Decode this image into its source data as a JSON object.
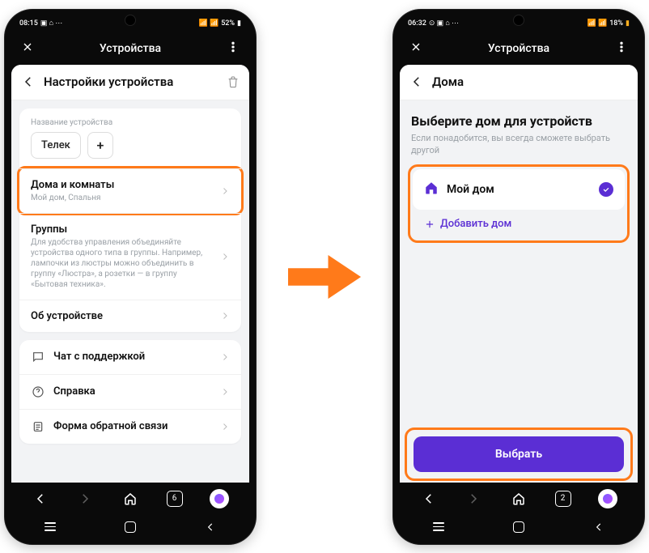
{
  "phone1": {
    "status": {
      "time": "08:15",
      "battery": "52%"
    },
    "topbar": {
      "title": "Устройства"
    },
    "subheader": {
      "title": "Настройки устройства"
    },
    "device_section": {
      "label": "Название устройства",
      "name_chip": "Телек",
      "plus": "+"
    },
    "rows": {
      "homes": {
        "title": "Дома и комнаты",
        "sub": "Мой дом, Спальня"
      },
      "groups": {
        "title": "Группы",
        "sub": "Для удобства управления объединяйте устройства одного типа в группы. Например, лампочки из люстры можно объединить в группу «Люстра», а розетки — в группу «Бытовая техника»."
      },
      "about": {
        "title": "Об устройстве"
      },
      "support": {
        "title": "Чат с поддержкой"
      },
      "help": {
        "title": "Справка"
      },
      "feedback": {
        "title": "Форма обратной связи"
      }
    },
    "browser": {
      "tab_count": "6"
    }
  },
  "phone2": {
    "status": {
      "time": "06:32",
      "battery": "18%"
    },
    "topbar": {
      "title": "Устройства"
    },
    "subheader": {
      "title": "Дома"
    },
    "heading": "Выберите дом для устройств",
    "subtext": "Если понадобится, вы всегда сможете выбрать другой",
    "home_item": {
      "title": "Мой дом"
    },
    "add_home": "Добавить дом",
    "primary_btn": "Выбрать",
    "browser": {
      "tab_count": "2"
    }
  }
}
